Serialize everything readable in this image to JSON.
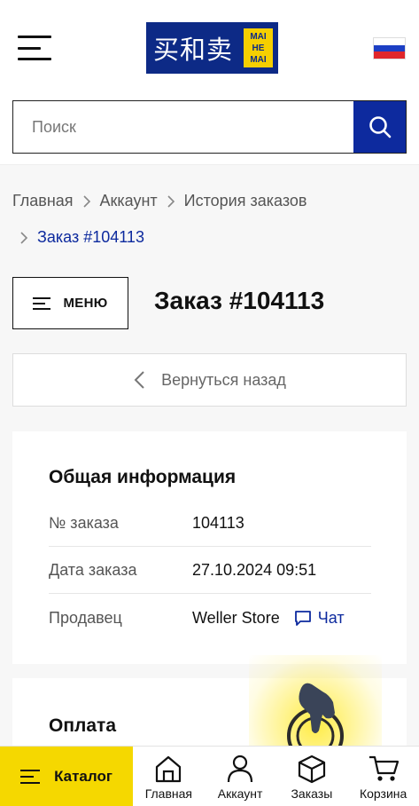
{
  "header": {
    "logo": {
      "chinese": "买和卖",
      "latin": [
        "MAI",
        "HE",
        "MAI"
      ]
    },
    "flag_colors": [
      "#ffffff",
      "#1c3fc4",
      "#e0262b"
    ],
    "search": {
      "placeholder": "Поиск",
      "value": ""
    }
  },
  "breadcrumb": {
    "items": [
      "Главная",
      "Аккаунт",
      "История заказов"
    ],
    "current": "Заказ #104113"
  },
  "toolbar": {
    "menu_label": "МЕНЮ"
  },
  "page": {
    "title": "Заказ #104113",
    "back_label": "Вернуться назад"
  },
  "general_info": {
    "title": "Общая информация",
    "rows": [
      {
        "label": "№ заказа",
        "value": "104113"
      },
      {
        "label": "Дата заказа",
        "value": "27.10.2024 09:51"
      },
      {
        "label": "Продавец",
        "value": "Weller Store"
      }
    ],
    "chat_label": "Чат"
  },
  "payment": {
    "title": "Оплата"
  },
  "bottom_nav": {
    "catalog_label": "Каталог",
    "items": [
      {
        "label": "Главная",
        "icon": "home-icon"
      },
      {
        "label": "Аккаунт",
        "icon": "user-icon"
      },
      {
        "label": "Заказы",
        "icon": "box-icon"
      },
      {
        "label": "Корзина",
        "icon": "cart-icon"
      }
    ]
  },
  "colors": {
    "brand_blue": "#0d2a9e",
    "brand_yellow": "#f5d800"
  }
}
